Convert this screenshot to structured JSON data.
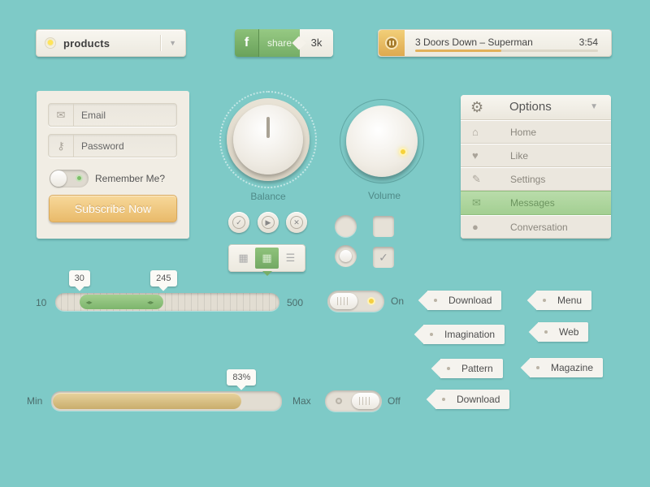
{
  "products_dropdown": {
    "label": "products"
  },
  "share": {
    "icon": "f",
    "label": "share",
    "count": "3k"
  },
  "player": {
    "title": "3 Doors Down – Superman",
    "time": "3:54",
    "progress": 0.47
  },
  "login": {
    "email_placeholder": "Email",
    "password_placeholder": "Password",
    "remember_label": "Remember Me?",
    "subscribe_label": "Subscribe Now"
  },
  "knobs": {
    "balance_label": "Balance",
    "volume_label": "Volume"
  },
  "options_menu": {
    "title": "Options",
    "items": [
      {
        "label": "Home",
        "icon": "home-icon"
      },
      {
        "label": "Like",
        "icon": "heart-icon"
      },
      {
        "label": "Settings",
        "icon": "wrench-icon"
      },
      {
        "label": "Messages",
        "icon": "envelope-icon",
        "active": true
      },
      {
        "label": "Conversation",
        "icon": "speech-bubble-icon"
      }
    ]
  },
  "range_slider": {
    "min_label": "10",
    "max_label": "500",
    "low": "30",
    "high": "245",
    "min": 10,
    "max": 500
  },
  "progress": {
    "min_label": "Min",
    "max_label": "Max",
    "value_label": "83%",
    "value": 0.83
  },
  "toggles": {
    "on_label": "On",
    "off_label": "Off"
  },
  "tags": {
    "download_1": "Download",
    "menu": "Menu",
    "imagination": "Imagination",
    "web": "Web",
    "pattern": "Pattern",
    "magazine": "Magazine",
    "download_2": "Download"
  },
  "colors": {
    "background": "#7ecac7",
    "accent_green": "#8cc078",
    "accent_gold": "#e9ba6a"
  }
}
